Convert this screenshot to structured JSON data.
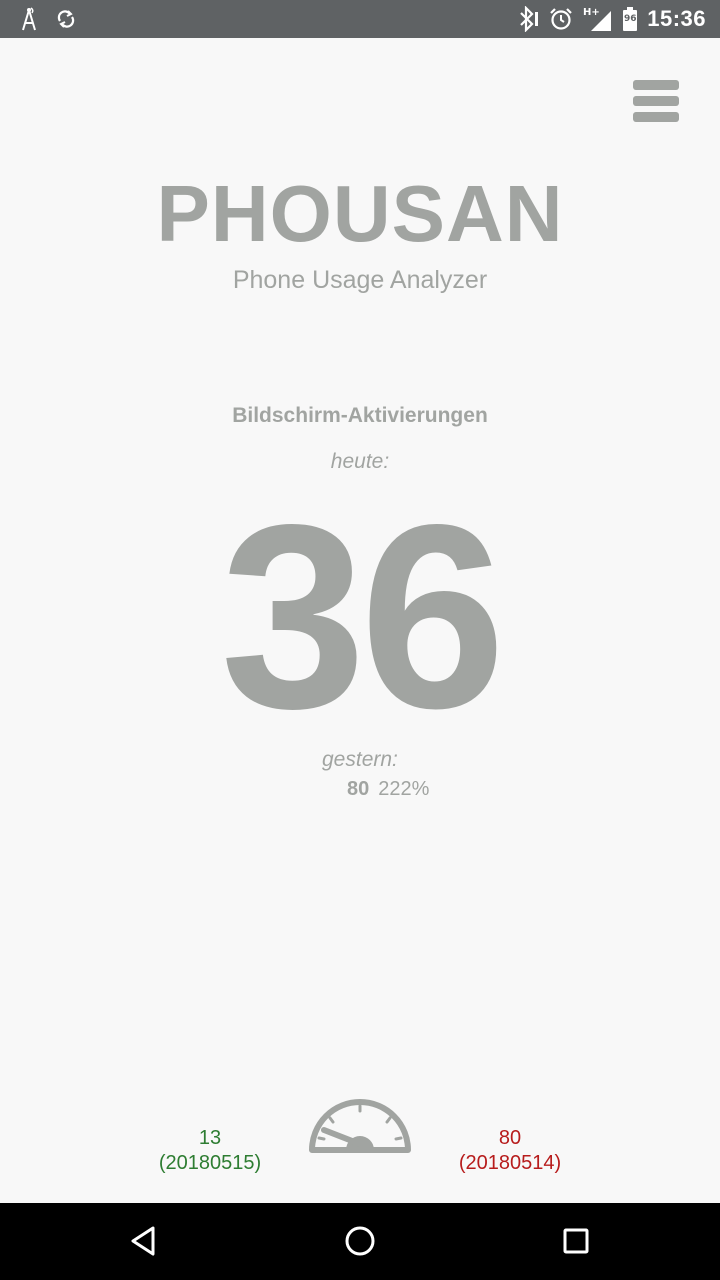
{
  "status_bar": {
    "time": "15:36",
    "battery_level": "96",
    "network_type": "H+",
    "left_icons": [
      "antenna-icon",
      "sync-icon"
    ],
    "right_icons": [
      "bluetooth-icon",
      "alarm-icon",
      "signal-icon",
      "battery-icon"
    ]
  },
  "header": {
    "menu_icon": "hamburger-menu-icon",
    "title": "PHOUSAN",
    "subtitle": "Phone Usage Analyzer"
  },
  "main": {
    "metric_title": "Bildschirm-Aktivierungen",
    "today_label": "heute:",
    "today_value": "36",
    "yesterday_label": "gestern:",
    "yesterday_value": "80",
    "yesterday_percent": "222%"
  },
  "footer": {
    "best": {
      "value": "13",
      "date": "(20180515)",
      "color": "#2e7d32"
    },
    "gauge_icon": "speedometer-icon",
    "worst": {
      "value": "80",
      "date": "(20180514)",
      "color": "#b71c1c"
    }
  },
  "nav_bar": {
    "buttons": [
      "back-icon",
      "home-icon",
      "recents-icon"
    ]
  },
  "colors": {
    "accent_gray": "#a1a4a1",
    "background": "#f8f8f8",
    "status_bar": "#5f6264"
  }
}
